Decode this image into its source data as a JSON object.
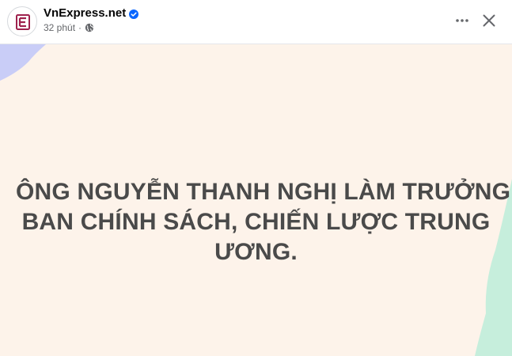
{
  "header": {
    "page_name": "VnExpress.net",
    "timestamp": "32 phút",
    "separator": "·",
    "verified_icon": "verified-badge-icon",
    "privacy_icon": "globe-icon",
    "more_icon": "more-horizontal-icon",
    "close_icon": "close-icon",
    "avatar_icon": "vnexpress-logo-icon"
  },
  "post": {
    "lines": [
      "ÔNG NGUYỄN THANH NGHỊ LÀM TRƯỞNG",
      "BAN CHÍNH SÁCH, CHIẾN LƯỢC TRUNG",
      "ƯƠNG."
    ],
    "background_color": "#fdf3ea",
    "accent_colors": {
      "top_left": "#c9cdf7",
      "bottom_right": "#c6eedc"
    },
    "text_color": "#4a4a4a"
  },
  "colors": {
    "brand_red": "#9f224e",
    "verified_blue": "#0866ff",
    "muted_text": "#65676b"
  }
}
